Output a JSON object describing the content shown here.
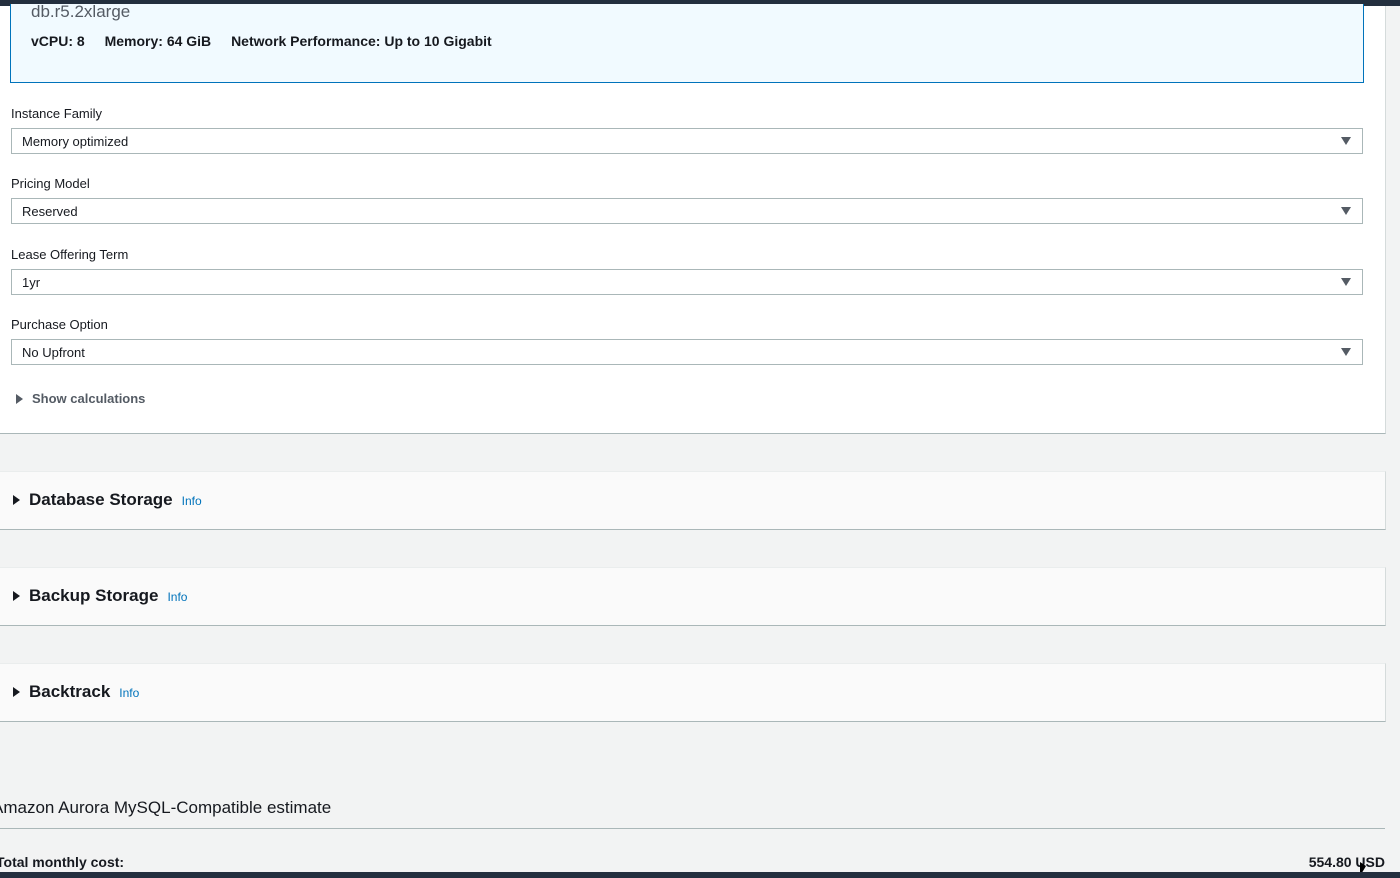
{
  "instance": {
    "name": "db.r5.2xlarge",
    "vcpu": "vCPU: 8",
    "memory": "Memory: 64 GiB",
    "network": "Network Performance: Up to 10 Gigabit"
  },
  "fields": [
    {
      "label": "Instance Family",
      "value": "Memory optimized"
    },
    {
      "label": "Pricing Model",
      "value": "Reserved"
    },
    {
      "label": "Lease Offering Term",
      "value": "1yr"
    },
    {
      "label": "Purchase Option",
      "value": "No Upfront"
    }
  ],
  "show_calculations": "Show calculations",
  "sections": [
    {
      "title": "Database Storage",
      "info": "Info"
    },
    {
      "title": "Backup Storage",
      "info": "Info"
    },
    {
      "title": "Backtrack",
      "info": "Info"
    }
  ],
  "estimate": {
    "title": "Amazon Aurora MySQL-Compatible estimate",
    "total_label": "Total monthly cost:",
    "total_value": "554.80 USD"
  }
}
